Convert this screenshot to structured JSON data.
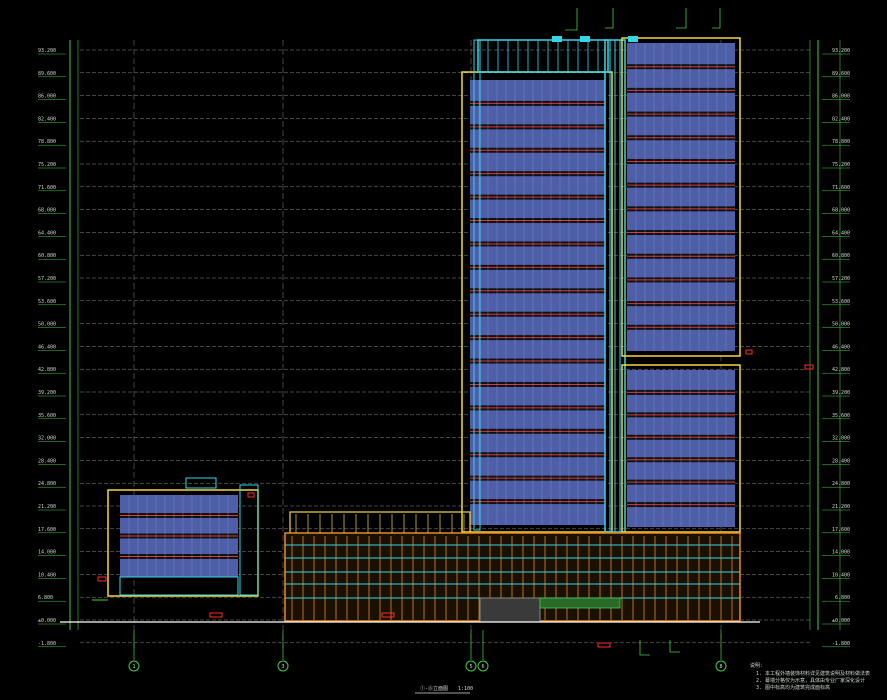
{
  "drawing": {
    "title_label": "①-⑧立面图",
    "scale_label": "1:100"
  },
  "left_elevation_labels": [
    "93.200",
    "89.600",
    "86.000",
    "82.400",
    "78.800",
    "75.200",
    "71.600",
    "68.000",
    "64.400",
    "60.800",
    "57.200",
    "53.600",
    "50.000",
    "46.400",
    "42.800",
    "39.200",
    "35.600",
    "32.000",
    "28.400",
    "24.800",
    "21.200",
    "17.600",
    "14.000",
    "10.400",
    "6.800",
    "±0.000",
    "-1.800"
  ],
  "right_elevation_labels": [
    "93.200",
    "89.600",
    "86.000",
    "82.400",
    "78.800",
    "75.200",
    "71.600",
    "68.000",
    "64.400",
    "60.800",
    "57.200",
    "53.600",
    "50.000",
    "46.400",
    "42.800",
    "39.200",
    "35.600",
    "32.000",
    "28.400",
    "24.800",
    "21.200",
    "17.600",
    "14.000",
    "10.400",
    "6.800",
    "±0.000",
    "-1.800"
  ],
  "axis_bubbles": [
    "1",
    "3",
    "5",
    "6",
    "8"
  ],
  "notes": {
    "heading": "说明：",
    "lines": [
      "1. 本工程外墙装饰材料详见建筑说明及材料做法表",
      "2. 幕墙分格仅为示意，具体由专业厂家深化设计",
      "3. 图中标高均为建筑完成面标高"
    ]
  },
  "colors": {
    "background": "#000000",
    "grid": "#9a9a9a",
    "curtain_wall": "#5a6ab8",
    "mullion": "#35d6e8",
    "frame": "#f5d642",
    "podium": "#e88a1f",
    "dimension": "#44cc44",
    "tag": "#ff2a2a"
  }
}
